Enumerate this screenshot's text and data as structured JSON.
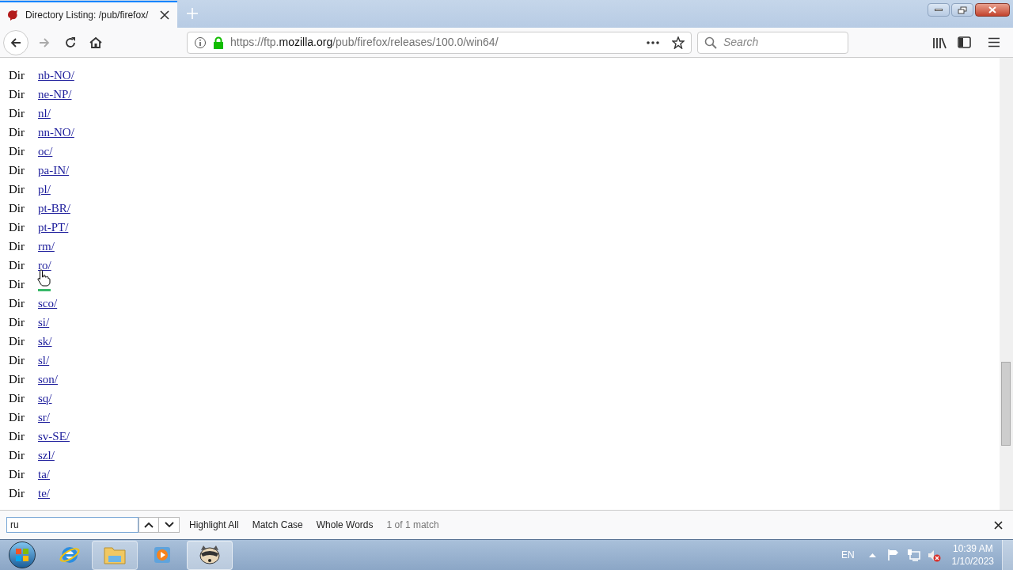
{
  "tab": {
    "title": "Directory Listing: /pub/firefox/"
  },
  "url": {
    "host_prefix": "https://ftp.",
    "domain": "mozilla.org",
    "path": "/pub/firefox/releases/100.0/win64/"
  },
  "search": {
    "placeholder": "Search"
  },
  "listing": [
    {
      "type": "Dir",
      "name": "nb-NO/",
      "found": false
    },
    {
      "type": "Dir",
      "name": "ne-NP/",
      "found": false
    },
    {
      "type": "Dir",
      "name": "nl/",
      "found": false
    },
    {
      "type": "Dir",
      "name": "nn-NO/",
      "found": false
    },
    {
      "type": "Dir",
      "name": "oc/",
      "found": false
    },
    {
      "type": "Dir",
      "name": "pa-IN/",
      "found": false
    },
    {
      "type": "Dir",
      "name": "pl/",
      "found": false
    },
    {
      "type": "Dir",
      "name": "pt-BR/",
      "found": false
    },
    {
      "type": "Dir",
      "name": "pt-PT/",
      "found": false
    },
    {
      "type": "Dir",
      "name": "rm/",
      "found": false
    },
    {
      "type": "Dir",
      "name": "ro/",
      "found": false
    },
    {
      "type": "Dir",
      "found": true
    },
    {
      "type": "Dir",
      "name": "sco/",
      "found": false
    },
    {
      "type": "Dir",
      "name": "si/",
      "found": false
    },
    {
      "type": "Dir",
      "name": "sk/",
      "found": false
    },
    {
      "type": "Dir",
      "name": "sl/",
      "found": false
    },
    {
      "type": "Dir",
      "name": "son/",
      "found": false
    },
    {
      "type": "Dir",
      "name": "sq/",
      "found": false
    },
    {
      "type": "Dir",
      "name": "sr/",
      "found": false
    },
    {
      "type": "Dir",
      "name": "sv-SE/",
      "found": false
    },
    {
      "type": "Dir",
      "name": "szl/",
      "found": false
    },
    {
      "type": "Dir",
      "name": "ta/",
      "found": false
    },
    {
      "type": "Dir",
      "name": "te/",
      "found": false
    }
  ],
  "find_bar": {
    "value": "ru",
    "options": [
      {
        "label": "Highlight All",
        "checked": false
      },
      {
        "label": "Match Case",
        "checked": false
      },
      {
        "label": "Whole Words",
        "checked": false
      }
    ],
    "result": "1 of 1 match"
  },
  "taskbar": {
    "language": "EN",
    "time": "10:39 AM",
    "date": "1/10/2023"
  }
}
